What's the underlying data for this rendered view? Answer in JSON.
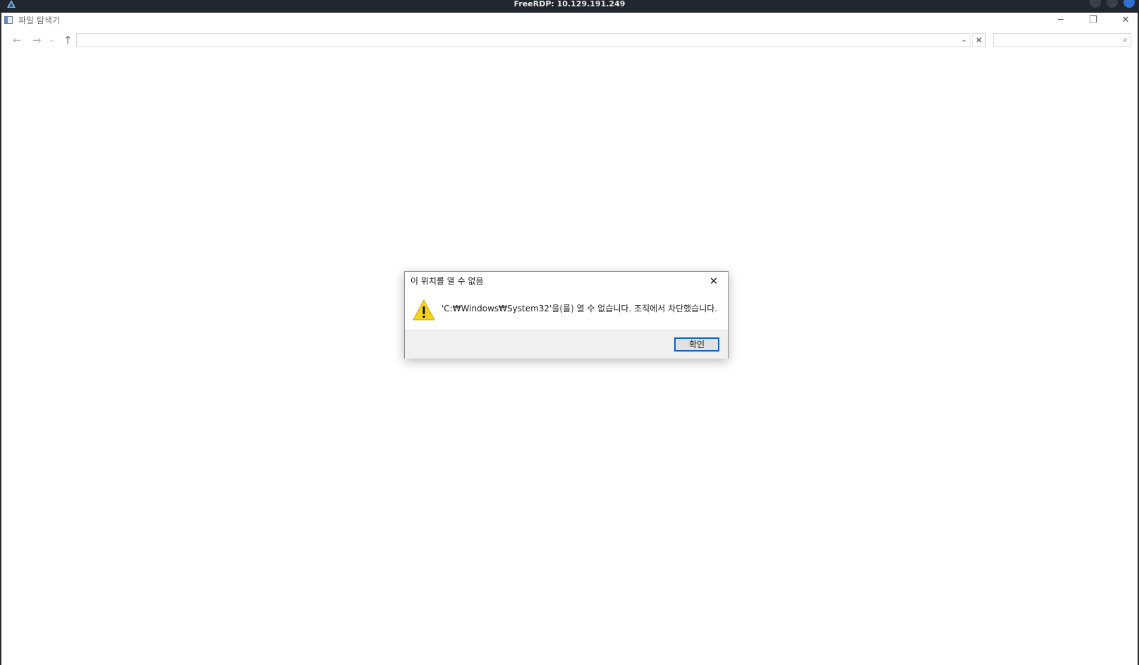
{
  "rdp": {
    "title": "FreeRDP: 10.129.191.249"
  },
  "window": {
    "title": "파일 탐색기",
    "icon": "file-explorer-icon",
    "controls": {
      "minimize": "─",
      "maximize": "❐",
      "close": "✕"
    }
  },
  "navigation": {
    "back_icon": "←",
    "forward_icon": "→",
    "recent_icon": "⌄",
    "up_icon": "↑",
    "address_value": "",
    "address_dropdown_icon": "⌄",
    "address_clear_icon": "✕",
    "search_value": "",
    "search_icon": "⌕"
  },
  "dialog": {
    "title": "이 위치를 열 수 없음",
    "close_icon": "✕",
    "icon": "warning-icon",
    "message": "'C:₩Windows₩System32'을(를) 열 수 없습니다. 조직에서 차단했습니다.",
    "ok_label": "확인"
  },
  "colors": {
    "rdp_bar": "#22262e",
    "button_focus_border": "#0a64c8",
    "warning_fill": "#f7d31c"
  }
}
